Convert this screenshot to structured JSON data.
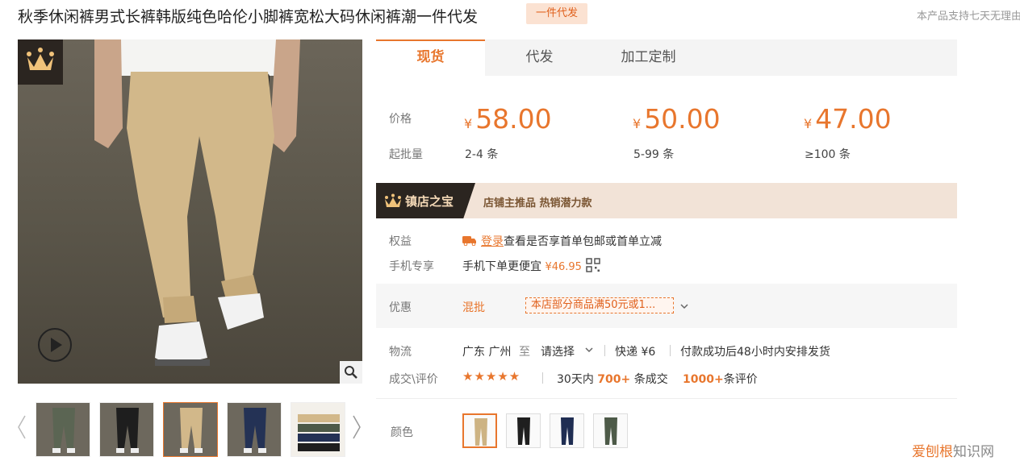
{
  "product": {
    "title": "秋季休闲裤男式长裤韩版纯色哈伦小脚裤宽松大码休闲裤潮一件代发",
    "badge": "一件代发",
    "notice": "本产品支持七天无理由"
  },
  "tabs": [
    {
      "label": "现货",
      "active": true
    },
    {
      "label": "代发",
      "active": false
    },
    {
      "label": "加工定制",
      "active": false
    }
  ],
  "pricing": {
    "price_label": "价格",
    "moq_label": "起批量",
    "currency": "¥",
    "tiers": [
      {
        "price": "58.00",
        "qty": "2-4 条"
      },
      {
        "price": "50.00",
        "qty": "5-99 条"
      },
      {
        "price": "47.00",
        "qty": "≥100 条"
      }
    ]
  },
  "treasure": {
    "title": "镇店之宝",
    "text": "店铺主推品  热销潜力款"
  },
  "benefits": {
    "label": "权益",
    "login": "登录",
    "text": "查看是否享首单包邮或首单立减"
  },
  "mobile": {
    "label": "手机专享",
    "text": "手机下单更便宜",
    "price": "¥46.95"
  },
  "promo": {
    "label": "优惠",
    "type": "混批",
    "tag": "本店部分商品满50元或1..."
  },
  "logistics": {
    "label": "物流",
    "origin": "广东 广州",
    "to": "至",
    "select": "请选择",
    "express": "快递 ¥6",
    "ship_note": "付款成功后48小时内安排发货"
  },
  "reviews": {
    "label": "成交\\评价",
    "stars": "★★★★★",
    "deals_prefix": "30天内",
    "deals_count": "700+",
    "deals_suffix": "条成交",
    "reviews_count": "1000+",
    "reviews_suffix": "条评价"
  },
  "color": {
    "label": "颜色"
  },
  "watermark": {
    "brand": "爱刨根",
    "suffix": "知识网"
  },
  "colors": {
    "accent": "#e8762d",
    "khaki": "#cdb383",
    "black": "#1f1f1f",
    "navy": "#1f2d52",
    "olive": "#4d5a48"
  }
}
